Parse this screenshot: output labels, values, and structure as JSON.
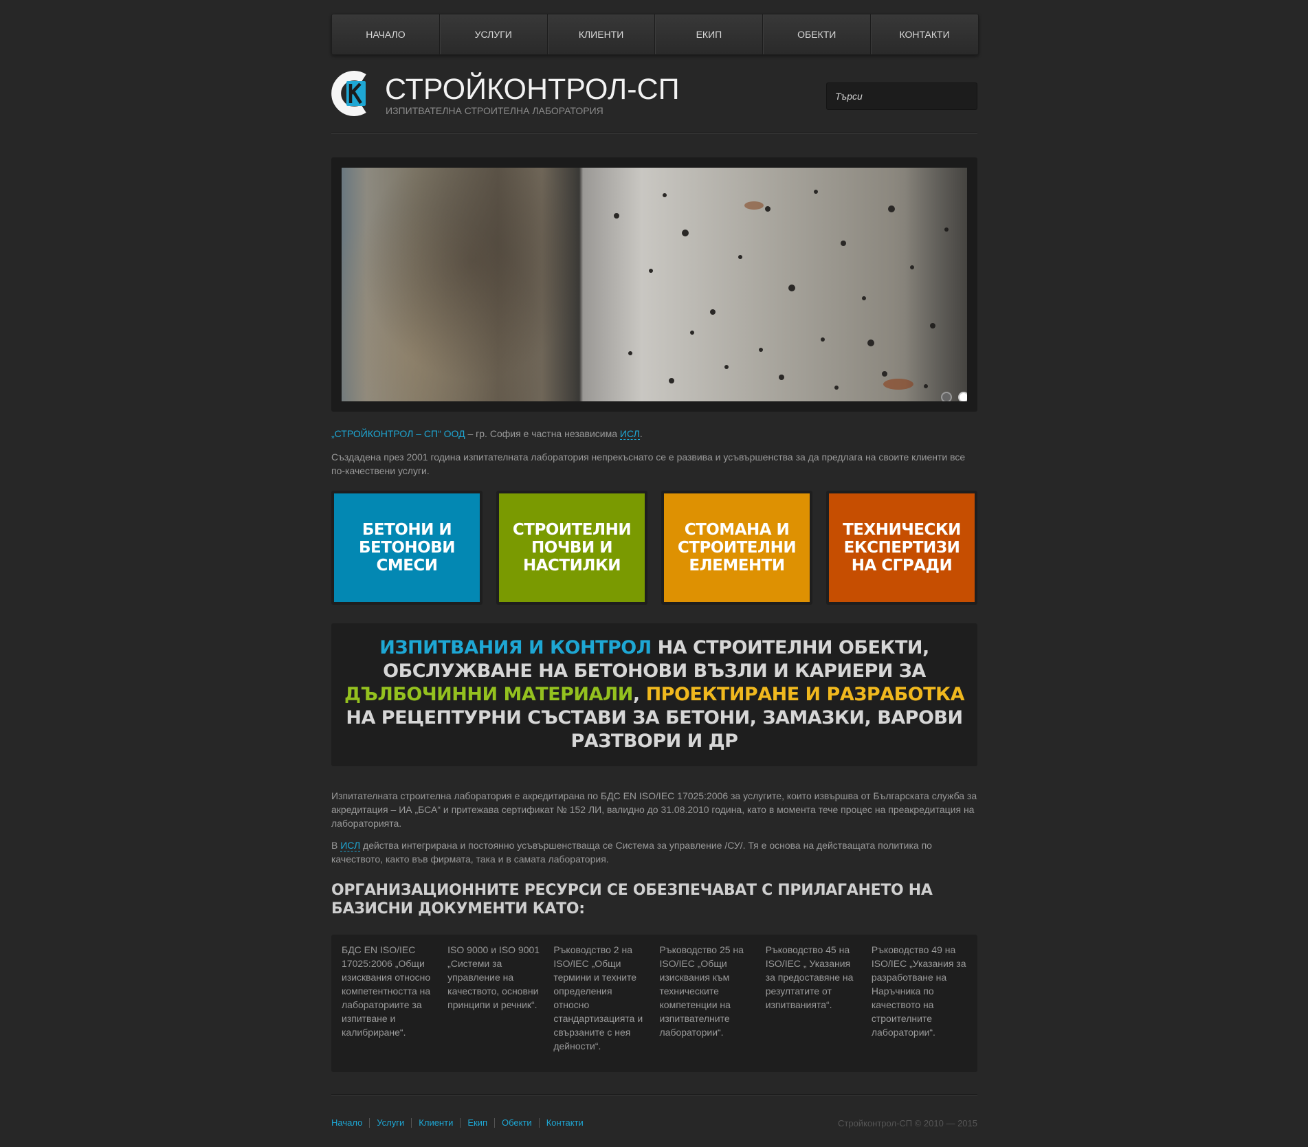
{
  "nav": [
    "НАЧАЛО",
    "УСЛУГИ",
    "КЛИЕНТИ",
    "ЕКИП",
    "ОБЕКТИ",
    "КОНТАКТИ"
  ],
  "header": {
    "logo_letters": "CK",
    "title": "СТРОЙКОНТРОЛ-СП",
    "subtitle": "ИЗПИТВАТЕЛНА СТРОИТЕЛНА ЛАБОРАТОРИЯ",
    "search_placeholder": "Търси"
  },
  "intro": {
    "company_link": "„СТРОЙКОНТРОЛ – СП“ ООД",
    "text": " – гр. София е частна независима ",
    "isl_link": "ИСЛ",
    "end": ".",
    "paragraph2": "Създадена през 2001 година изпитателната лаборатория  непрекъснато се е развива и усъвършенства за да предлага на своите клиенти все по-качествени услуги."
  },
  "tiles": [
    {
      "label": "БЕТОНИ И БЕТОНОВИ СМЕСИ",
      "color": "#0388b3"
    },
    {
      "label": "СТРОИТЕЛНИ ПОЧВИ И НАСТИЛКИ",
      "color": "#7a9a01"
    },
    {
      "label": "СТОМАНА И СТРОИТЕЛНИ ЕЛЕМЕНТИ",
      "color": "#de9102"
    },
    {
      "label": "ТЕХНИЧЕСКИ ЕКСПЕРТИЗИ НА СГРАДИ",
      "color": "#c64e01"
    }
  ],
  "banner": {
    "part1": "ИЗПИТВАНИЯ И КОНТРОЛ",
    "part2": " НА СТРОИТЕЛНИ ОБЕКТИ, ОБСЛУЖВАНЕ НА БЕТОНОВИ ВЪЗЛИ И КАРИЕРИ ЗА ",
    "part3": "ДЪЛБОЧИННИ МАТЕРИАЛИ",
    "part4": ", ",
    "part5": "ПРОЕКТИРАНЕ И РАЗРАБОТКА",
    "part6": " НА РЕЦЕПТУРНИ СЪСТАВИ ЗА БЕТОНИ, ЗАМАЗКИ, ВАРОВИ РАЗТВОРИ И ДР"
  },
  "accreditation": "Изпитателната строителна лаборатория  е акредитирана по БДС EN ISO/IEC 17025:2006 за услугите, които извършва от Българската служба за акредитация – ИА „БСА“ и притежава сертификат № 152 ЛИ, валидно до 31.08.2010 година, като в момента тече процес на преакредитация на лабораторията.",
  "quality": {
    "prefix": "В ",
    "isl_link": "ИСЛ",
    "text": " действа интегрирана и постоянно усъвършенстваща се Система за управление /СУ/. Тя е основа на действащата политика по качеството, както във фирмата, така и в самата лаборатория."
  },
  "docs_heading": "ОРГАНИЗАЦИОННИТЕ РЕСУРСИ СЕ ОБЕЗПЕЧАВАТ С ПРИЛАГАНЕТО НА БАЗИСНИ ДОКУМЕНТИ КАТО:",
  "docs": [
    "БДС EN ISO/IEC 17025:2006 „Общи изисквания относно компетентността на лабораториите за изпитване и калибриране“.",
    "ISO 9000 и ISO 9001 „Системи за управление на качеството, основни принципи и речник“.",
    "Ръководство 2 на ISO/IEC „Общи термини и техните определения относно стандартизацията и свързаните с нея дейности“.",
    "Ръководство 25 на ISO/IEC „Общи изисквания към техническите компетенции на изпитвателните лаборатории“.",
    "Ръководство 45 на ISO/IEC „ Указания за предоставяне на резултатите от изпитванията“.",
    "Ръководство 49 на ISO/IEC „Указания за разработване на Наръчника по качеството на строителните лаборатории“."
  ],
  "footer": {
    "links": [
      "Начало",
      "Услуги",
      "Клиенти",
      "Екип",
      "Обекти",
      "Контакти"
    ],
    "copyright": "Стройконтрол-СП © 2010 — 2015"
  }
}
